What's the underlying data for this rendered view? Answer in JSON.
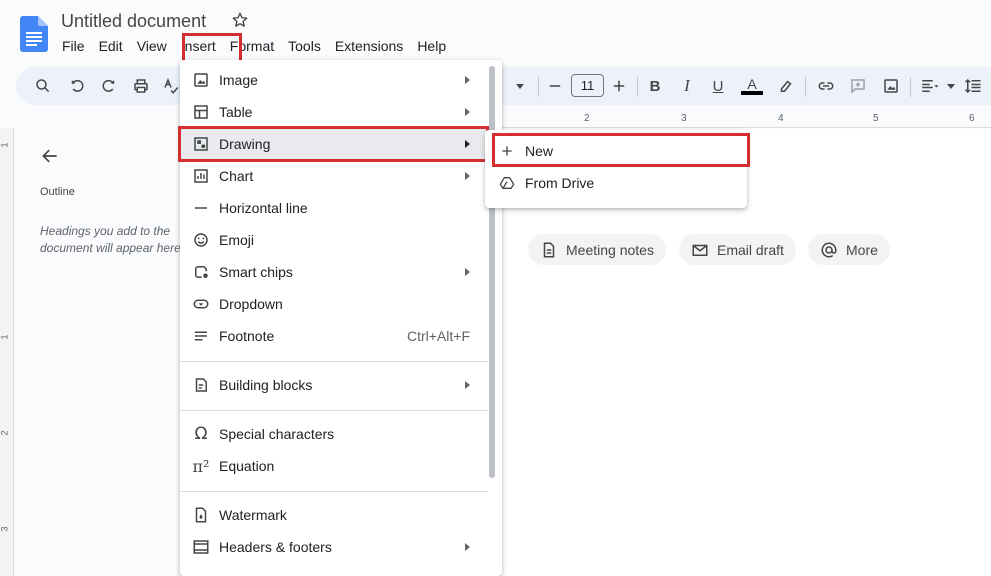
{
  "app": {
    "title": "Untitled document",
    "accent_color": "#1a73e8",
    "highlight_color": "#d32f2f"
  },
  "menubar": {
    "items": [
      "File",
      "Edit",
      "View",
      "Insert",
      "Format",
      "Tools",
      "Extensions",
      "Help"
    ]
  },
  "toolbar": {
    "font_size": "11",
    "icons": [
      "search-icon",
      "undo-icon",
      "redo-icon",
      "print-icon",
      "spellcheck-icon",
      "dropdown-icon",
      "minus-icon",
      "plus-icon",
      "bold-icon",
      "italic-icon",
      "text-color-icon",
      "highlight-icon",
      "link-icon",
      "comment-icon",
      "image-icon",
      "align-icon",
      "line-spacing-icon"
    ],
    "bold": "B",
    "italic": "I",
    "text_color": "A"
  },
  "outline": {
    "title": "Outline",
    "hint": "Headings you add to the document will appear here."
  },
  "ruler": {
    "h_ticks": [
      "2",
      "3",
      "4",
      "5",
      "6"
    ],
    "v_ticks": [
      "1",
      "1",
      "2",
      "3"
    ]
  },
  "chips": [
    {
      "label": "Meeting notes",
      "icon": "document-icon"
    },
    {
      "label": "Email draft",
      "icon": "email-icon"
    },
    {
      "label": "More",
      "icon": "at-sign-icon"
    }
  ],
  "insert_menu": {
    "items": [
      {
        "label": "Image",
        "icon": "image-icon",
        "submenu": true
      },
      {
        "label": "Table",
        "icon": "table-icon",
        "submenu": true
      },
      {
        "label": "Drawing",
        "icon": "drawing-icon",
        "submenu": true
      },
      {
        "label": "Chart",
        "icon": "chart-icon",
        "submenu": true
      },
      {
        "label": "Horizontal line",
        "icon": "horizontal-line-icon",
        "submenu": false
      },
      {
        "label": "Emoji",
        "icon": "emoji-icon",
        "submenu": false
      },
      {
        "label": "Smart chips",
        "icon": "smart-chips-icon",
        "submenu": true
      },
      {
        "label": "Dropdown",
        "icon": "dropdown-chip-icon",
        "submenu": false
      },
      {
        "label": "Footnote",
        "icon": "footnote-icon",
        "submenu": false,
        "shortcut": "Ctrl+Alt+F"
      },
      {
        "label": "Building blocks",
        "icon": "building-blocks-icon",
        "submenu": true
      },
      {
        "label": "Special characters",
        "icon": "omega-icon",
        "submenu": false
      },
      {
        "label": "Equation",
        "icon": "pi-icon",
        "submenu": false
      },
      {
        "label": "Watermark",
        "icon": "watermark-icon",
        "submenu": false
      },
      {
        "label": "Headers & footers",
        "icon": "headers-footers-icon",
        "submenu": true
      }
    ]
  },
  "drawing_submenu": {
    "items": [
      {
        "label": "New",
        "icon": "plus-icon"
      },
      {
        "label": "From Drive",
        "icon": "drive-icon"
      }
    ]
  }
}
